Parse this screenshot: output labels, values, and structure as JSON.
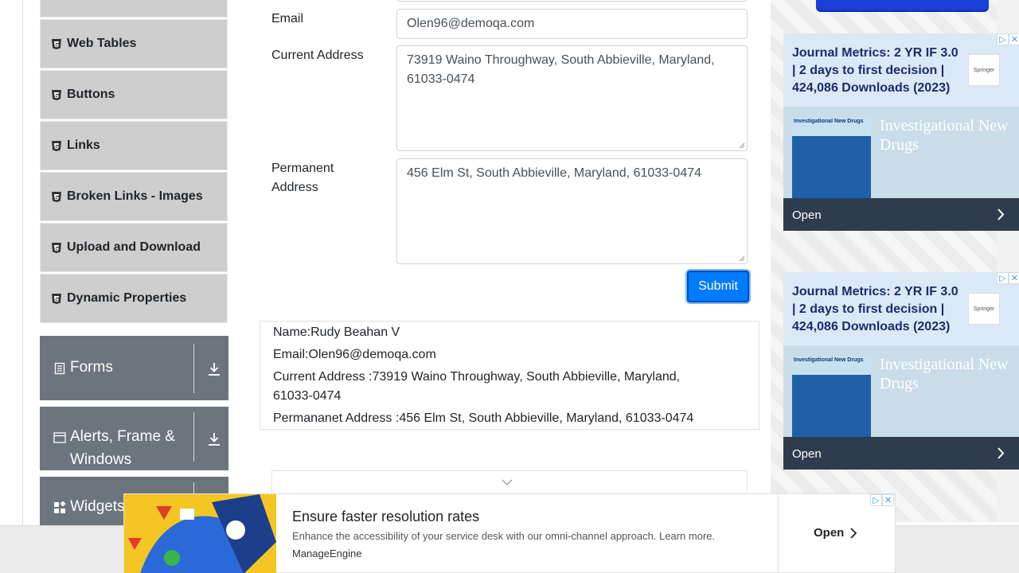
{
  "sidebar": {
    "elements_items": [
      {
        "label": "Web Tables"
      },
      {
        "label": "Buttons"
      },
      {
        "label": "Links"
      },
      {
        "label": "Broken Links - Images"
      },
      {
        "label": "Upload and Download"
      },
      {
        "label": "Dynamic Properties"
      }
    ],
    "groups": [
      {
        "label": "Forms",
        "icon": "document-icon"
      },
      {
        "label": "Alerts, Frame &",
        "label2": "Windows",
        "icon": "window-icon"
      },
      {
        "label": "Widgets",
        "icon": "grid-icon"
      }
    ]
  },
  "form": {
    "email_label": "Email",
    "email_value": "Olen96@demoqa.com",
    "current_label": "Current Address",
    "current_value": "73919 Waino Throughway, South Abbieville, Maryland, 61033-0474",
    "permanent_label_1": "Permanent",
    "permanent_label_2": "Address",
    "permanent_value": "456 Elm St, South Abbieville, Maryland, 61033-0474",
    "submit_label": "Submit"
  },
  "output": {
    "name": "Name:Rudy Beahan V",
    "email": "Email:Olen96@demoqa.com",
    "current": "Current Address :73919 Waino Throughway, South Abbieville, Maryland, 61033-0474",
    "permanent": "Permananet Address :456 Elm St, South Abbieville, Maryland, 61033-0474"
  },
  "ads": {
    "side_title": "Journal Metrics: 2 YR IF 3.0 | 2 days to first decision | 424,086 Downloads (2023)",
    "springer": "Springer",
    "cover_title": "Investigational New Drugs",
    "journal_name": "Investigational New Drugs",
    "open_label": "Open",
    "banner_heading": "Ensure faster resolution rates",
    "banner_desc": "Enhance the accessibility of your service desk with our omni-channel approach. Learn more.",
    "banner_brand": "ManageEngine",
    "banner_open": "Open"
  },
  "colors": {
    "accent": "#007bff",
    "sidebar_group": "#6c757d",
    "sidebar_item": "#cecece"
  }
}
